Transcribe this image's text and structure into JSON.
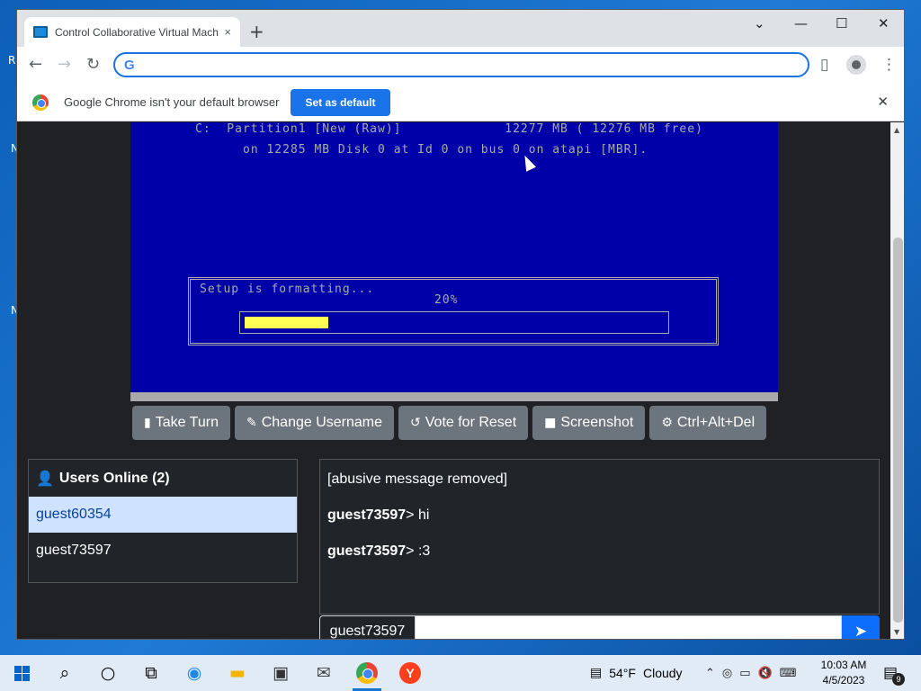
{
  "desktop": {
    "glyphs": [
      "R",
      "N",
      "N"
    ]
  },
  "browser": {
    "tab_title": "Control Collaborative Virtual Machine",
    "tab_close": "×",
    "new_tab": "+",
    "win_minimize": "—",
    "win_maximize": "☐",
    "win_close": "✕",
    "win_dropdown": "⌄",
    "address_value": "",
    "address_placeholder": "",
    "infobar_text": "Google Chrome isn't your default browser",
    "infobar_button": "Set as default",
    "infobar_close": "✕",
    "icons": {
      "back": "back-arrow-icon",
      "forward": "forward-arrow-icon",
      "reload": "reload-icon",
      "sidepanel": "side-panel-icon",
      "profile": "profile-icon",
      "menu": "menu-icon"
    }
  },
  "vm": {
    "line1": "C:  Partition1 [New (Raw)]             12277 MB ( 12276 MB free)",
    "line2": "on 12285 MB Disk 0 at Id 0 on bus 0 on atapi [MBR].",
    "status_text": "Setup is formatting...",
    "percent_text": "20%",
    "progress_fraction": 0.2,
    "colors": {
      "background": "#0000a8",
      "text": "#aaaaaa",
      "progress": "#ffff55"
    }
  },
  "controls": {
    "take_turn": "Take Turn",
    "change_username": "Change Username",
    "vote_reset": "Vote for Reset",
    "screenshot": "Screenshot",
    "ctrl_alt_del": "Ctrl+Alt+Del"
  },
  "users": {
    "header": "Users Online (2)",
    "list": [
      "guest60354",
      "guest73597"
    ]
  },
  "chat": {
    "messages": [
      {
        "user": "",
        "text": "[abusive message removed]"
      },
      {
        "user": "guest73597",
        "sep": ">",
        "text": " hi"
      },
      {
        "user": "guest73597",
        "sep": ">",
        "text": " :3"
      }
    ],
    "username": "guest73597",
    "input_value": "",
    "send_icon": "paper-plane-icon"
  },
  "taskbar": {
    "weather_temp": "54°F",
    "weather_text": "Cloudy",
    "time": "10:03 AM",
    "date": "4/5/2023",
    "notification_count": "9"
  },
  "colors": {
    "accent": "#1a73e8",
    "send": "#0d6efd",
    "selected_user_bg": "#cfe2ff",
    "button_gray": "#6c757d",
    "page_bg": "#202124"
  }
}
